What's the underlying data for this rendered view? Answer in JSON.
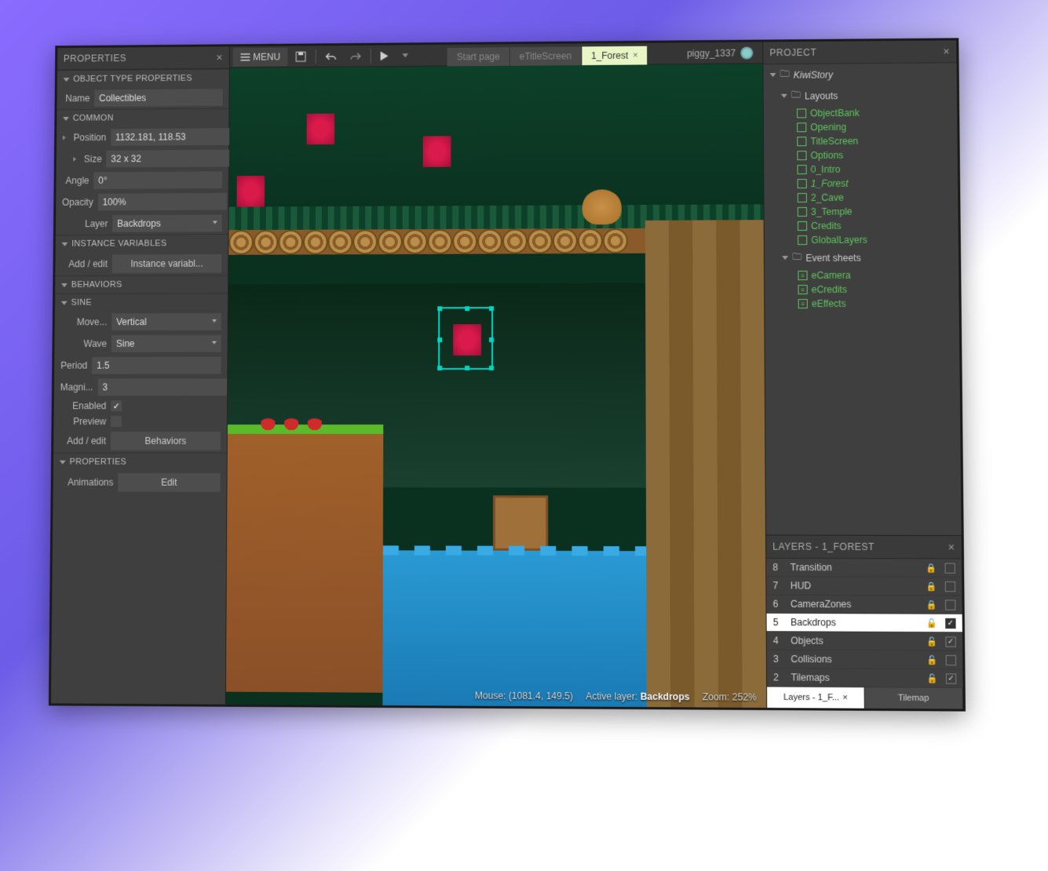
{
  "properties": {
    "title": "PROPERTIES",
    "sections": {
      "objectType": {
        "header": "OBJECT TYPE PROPERTIES",
        "name_label": "Name",
        "name_value": "Collectibles"
      },
      "common": {
        "header": "COMMON",
        "position_label": "Position",
        "position_value": "1132.181, 118.53",
        "size_label": "Size",
        "size_value": "32 x 32",
        "angle_label": "Angle",
        "angle_value": "0°",
        "opacity_label": "Opacity",
        "opacity_value": "100%",
        "layer_label": "Layer",
        "layer_value": "Backdrops"
      },
      "instanceVars": {
        "header": "INSTANCE VARIABLES",
        "addedit_label": "Add / edit",
        "btn": "Instance variabl..."
      },
      "behaviors": {
        "header": "BEHAVIORS"
      },
      "sine": {
        "header": "SINE",
        "move_label": "Move...",
        "move_value": "Vertical",
        "wave_label": "Wave",
        "wave_value": "Sine",
        "period_label": "Period",
        "period_value": "1.5",
        "magni_label": "Magni...",
        "magni_value": "3",
        "enabled_label": "Enabled",
        "enabled_value": true,
        "preview_label": "Preview",
        "preview_value": false,
        "addedit_label": "Add / edit",
        "btn": "Behaviors"
      },
      "props2": {
        "header": "PROPERTIES",
        "anim_label": "Animations",
        "btn": "Edit"
      }
    }
  },
  "toolbar": {
    "menu_label": "MENU",
    "tabs": [
      {
        "label": "Start page"
      },
      {
        "label": "eTitleScreen"
      },
      {
        "label": "1_Forest",
        "active": true
      }
    ],
    "user": "piggy_1337"
  },
  "status": {
    "mouse_label": "Mouse:",
    "mouse_value": "(1081.4, 149.5)",
    "active_label": "Active layer:",
    "active_value": "Backdrops",
    "zoom_label": "Zoom:",
    "zoom_value": "252%"
  },
  "project": {
    "title": "PROJECT",
    "root": "KiwiStory",
    "layouts_label": "Layouts",
    "layouts": [
      "ObjectBank",
      "Opening",
      "TitleScreen",
      "Options",
      "0_Intro",
      "1_Forest",
      "2_Cave",
      "3_Temple",
      "Credits",
      "GlobalLayers"
    ],
    "active_layout": "1_Forest",
    "eventsheets_label": "Event sheets",
    "eventsheets": [
      "eCamera",
      "eCredits",
      "eEffects"
    ]
  },
  "layers": {
    "title": "LAYERS - 1_FOREST",
    "items": [
      {
        "num": "8",
        "name": "Transition",
        "locked": true,
        "visible": false
      },
      {
        "num": "7",
        "name": "HUD",
        "locked": true,
        "visible": false
      },
      {
        "num": "6",
        "name": "CameraZones",
        "locked": true,
        "visible": false
      },
      {
        "num": "5",
        "name": "Backdrops",
        "locked": false,
        "visible": true,
        "selected": true
      },
      {
        "num": "4",
        "name": "Objects",
        "locked": false,
        "visible": true
      },
      {
        "num": "3",
        "name": "Collisions",
        "locked": false,
        "visible": false
      },
      {
        "num": "2",
        "name": "Tilemaps",
        "locked": false,
        "visible": true
      }
    ],
    "bottom_tabs": [
      {
        "label": "Layers - 1_F...",
        "active": true,
        "closable": true
      },
      {
        "label": "Tilemap"
      }
    ]
  }
}
